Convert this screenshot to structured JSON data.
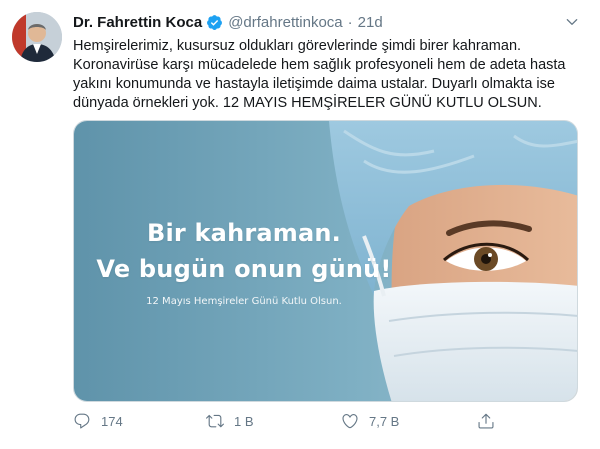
{
  "author": {
    "name": "Dr. Fahrettin Koca",
    "handle": "@drfahrettinkoca",
    "separator": "·",
    "time": "21d"
  },
  "tweet": {
    "lines": [
      "Hemşirelerimiz, kusursuz oldukları görevlerinde şimdi birer kahraman.",
      "Koronavirüse karşı mücadelede hem sağlık profesyoneli hem de adeta hasta",
      "yakını konumunda ve hastayla iletişimde daima ustalar. Duyarlı olmakta ise",
      "dünyada örnekleri yok. 12 MAYIS HEMŞİRELER GÜNÜ KUTLU OLSUN."
    ]
  },
  "media": {
    "title_line1": "Bir kahraman.",
    "title_line2": "Ve bugün onun günü!",
    "subtitle": "12 Mayıs Hemşireler Günü Kutlu Olsun."
  },
  "actions": {
    "reply_count": "174",
    "retweet_count": "1 B",
    "like_count": "7,7 B"
  },
  "colors": {
    "text_primary": "#14171a",
    "text_secondary": "#657786",
    "verified": "#1da1f2",
    "media_bg": "#6f9fb4"
  },
  "icons": {
    "verified": "verified-badge-icon",
    "menu": "chevron-down-icon",
    "reply": "reply-icon",
    "retweet": "retweet-icon",
    "like": "heart-icon",
    "share": "share-icon"
  }
}
